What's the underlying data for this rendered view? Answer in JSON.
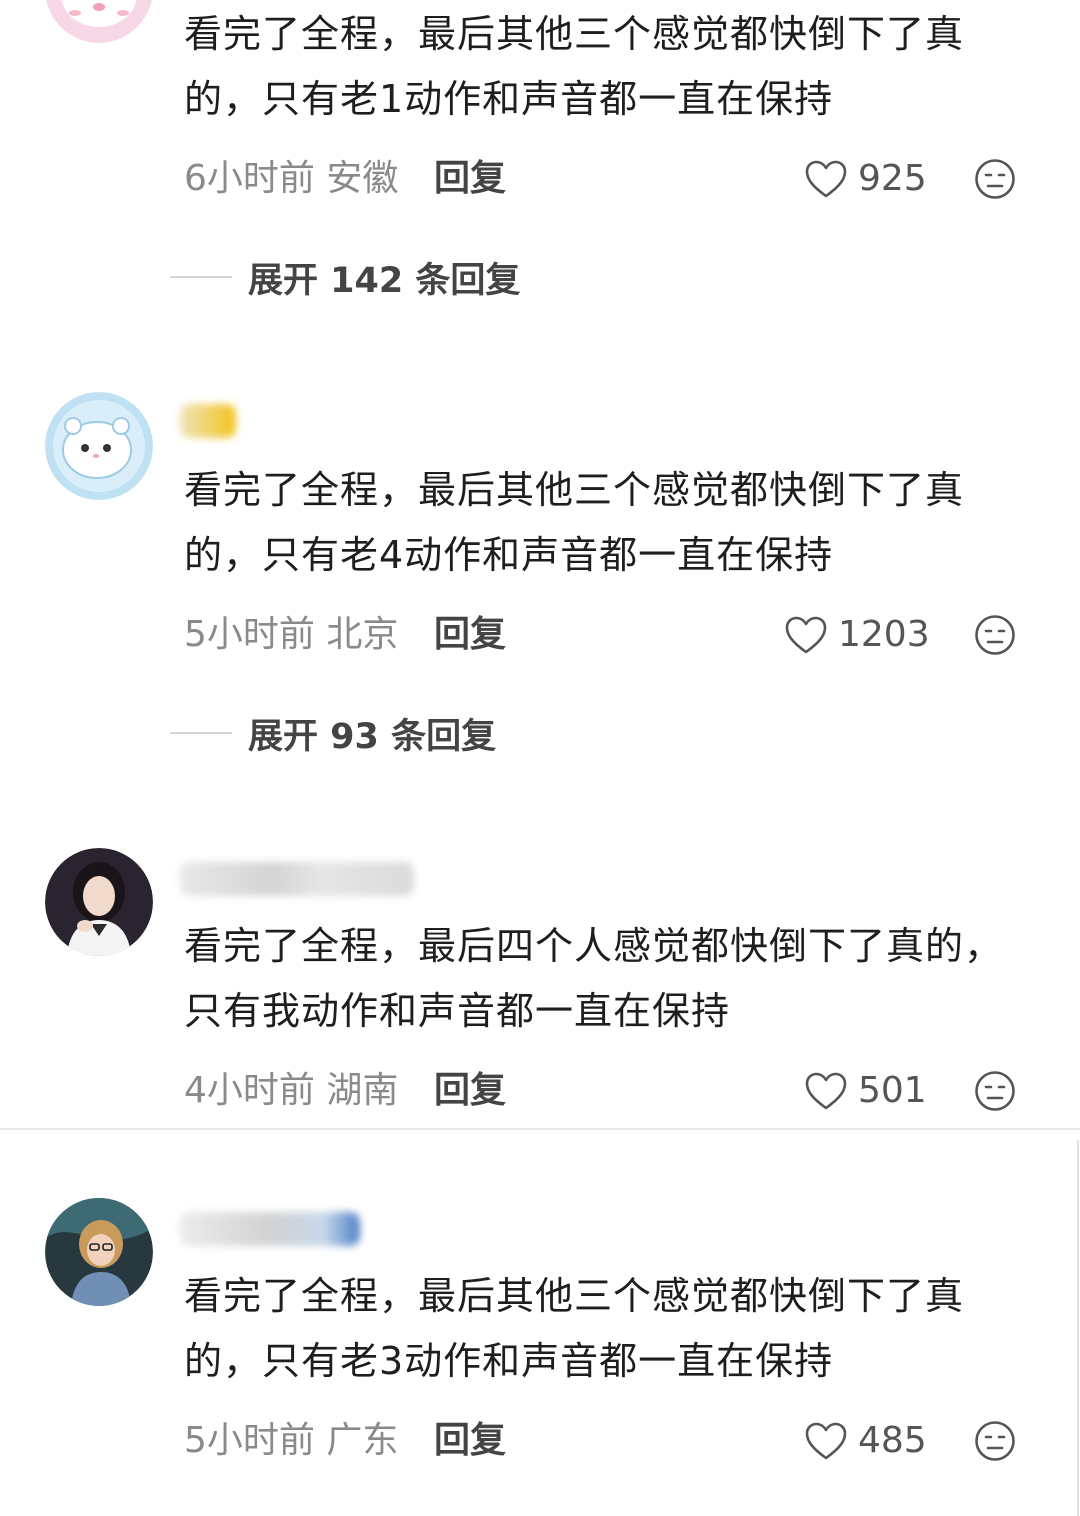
{
  "comments": [
    {
      "text": "看完了全程，最后其他三个感觉都快倒下了真的，只有老1动作和声音都一直在保持",
      "time_location": "6小时前 安徽",
      "reply_label": "回复",
      "likes": "925",
      "expand_label": "展开 142 条回复"
    },
    {
      "text": "看完了全程，最后其他三个感觉都快倒下了真的，只有老4动作和声音都一直在保持",
      "time_location": "5小时前 北京",
      "reply_label": "回复",
      "likes": "1203",
      "expand_label": "展开 93 条回复"
    },
    {
      "text": "看完了全程，最后四个人感觉都快倒下了真的，只有我动作和声音都一直在保持",
      "time_location": "4小时前 湖南",
      "reply_label": "回复",
      "likes": "501"
    },
    {
      "text": "看完了全程，最后其他三个感觉都快倒下了真的，只有老3动作和声音都一直在保持",
      "time_location": "5小时前 广东",
      "reply_label": "回复",
      "likes": "485"
    }
  ],
  "icons": {
    "like": "heart-outline-icon",
    "dislike": "unhappy-face-icon"
  },
  "colors": {
    "text": "#1e1e1e",
    "meta": "#8a8a8a",
    "action": "#444444"
  }
}
